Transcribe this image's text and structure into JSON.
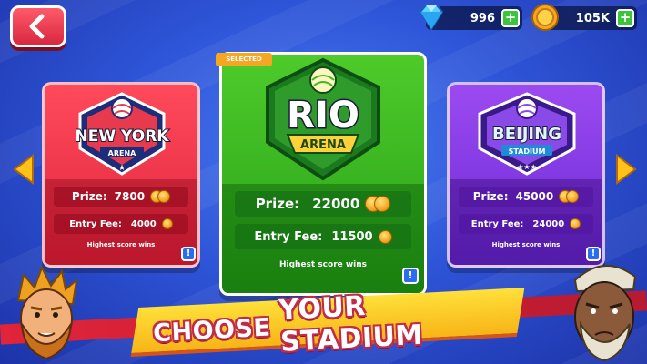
{
  "header": {
    "back_icon": "back-arrow-icon",
    "gems": {
      "value": "996",
      "plus": "+",
      "icon": "diamond-icon"
    },
    "coins": {
      "value": "105K",
      "plus": "+",
      "icon": "coin-icon"
    }
  },
  "selected_tag": "SELECTED",
  "arenas": [
    {
      "id": "new-york",
      "logo_line1": "NEW YORK",
      "logo_line2": "ARENA",
      "prize_label": "Prize:",
      "prize_value": "7800",
      "fee_label": "Entry Fee:",
      "fee_value": "4000",
      "note": "Highest score wins",
      "info": "!",
      "color": "#e8334a"
    },
    {
      "id": "rio",
      "logo_line1": "RIO",
      "logo_line2": "ARENA",
      "prize_label": "Prize:",
      "prize_value": "22000",
      "fee_label": "Entry Fee:",
      "fee_value": "11500",
      "note": "Highest score wins",
      "info": "!",
      "color": "#3cba22",
      "selected": true
    },
    {
      "id": "beijing",
      "logo_line1": "BEIJING",
      "logo_line2": "STADIUM",
      "prize_label": "Prize:",
      "prize_value": "45000",
      "fee_label": "Entry Fee:",
      "fee_value": "24000",
      "note": "Highest score wins",
      "info": "!",
      "color": "#8440e8"
    }
  ],
  "navigation": {
    "left_icon": "left-arrow-icon",
    "right_icon": "right-arrow-icon"
  },
  "banner": {
    "word1": "CHOOSE",
    "word2": "YOUR STADIUM"
  }
}
